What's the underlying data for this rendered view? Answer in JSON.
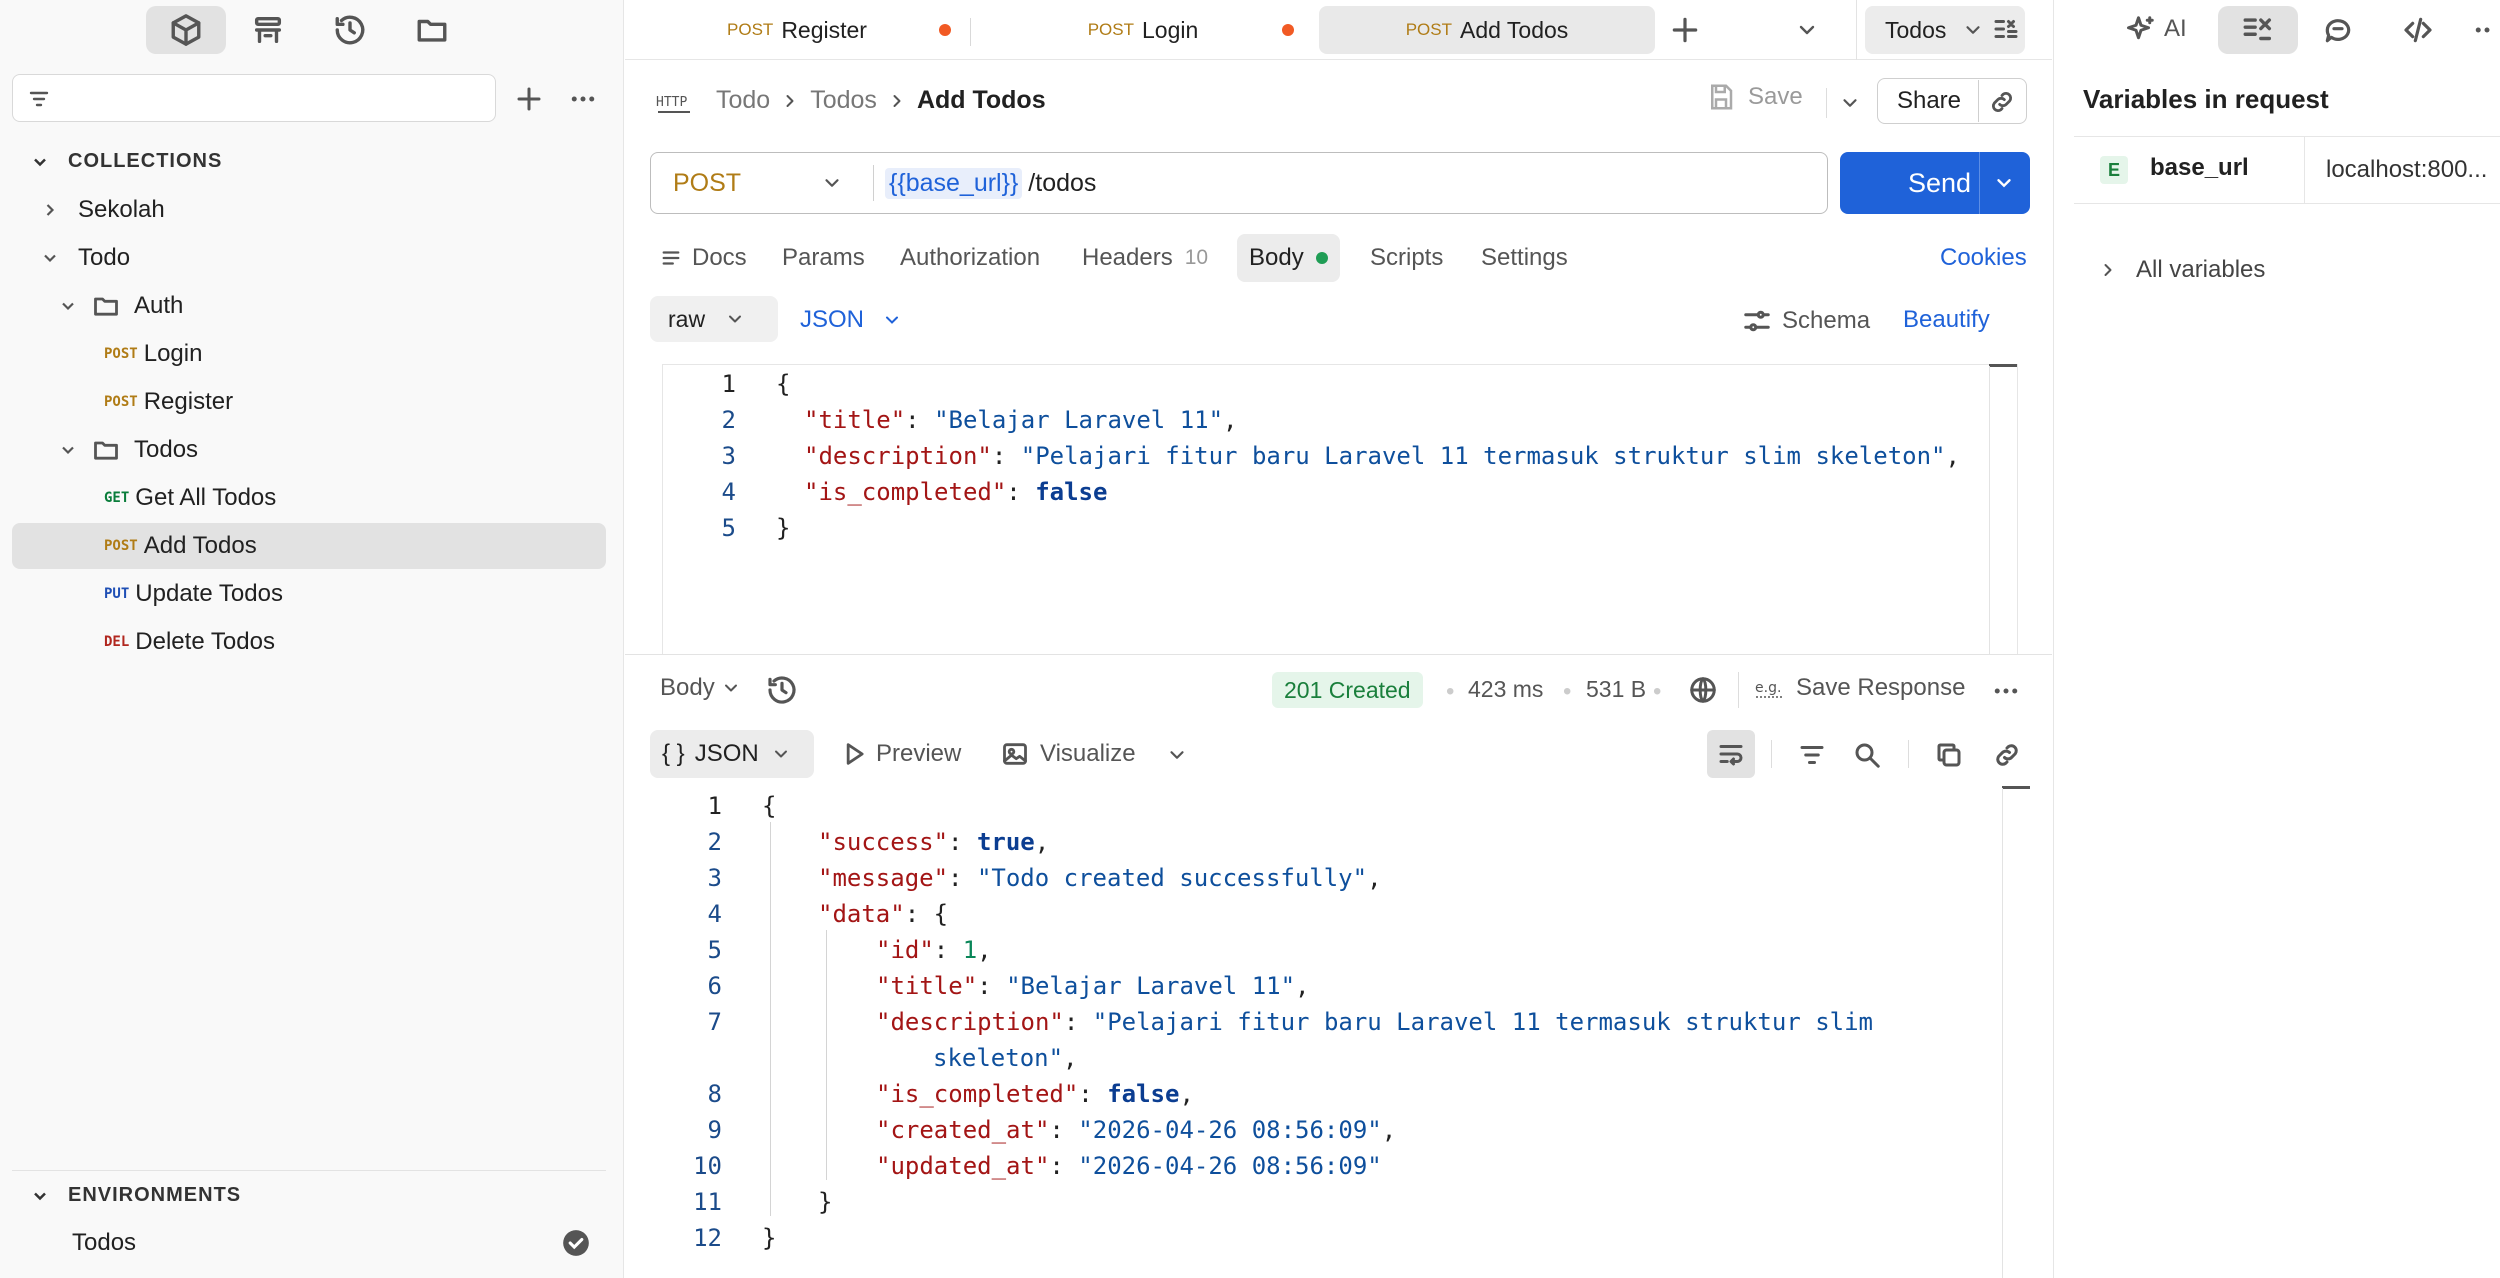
{
  "sidebar": {
    "collections_heading": "COLLECTIONS",
    "environments_heading": "ENVIRONMENTS",
    "tree": [
      {
        "label": "Sekolah"
      },
      {
        "label": "Todo"
      },
      {
        "label": "Auth"
      },
      {
        "method": "POST",
        "label": "Login"
      },
      {
        "method": "POST",
        "label": "Register"
      },
      {
        "label": "Todos"
      },
      {
        "method": "GET",
        "label": "Get All Todos"
      },
      {
        "method": "POST",
        "label": "Add Todos"
      },
      {
        "method": "PUT",
        "label": "Update Todos"
      },
      {
        "method": "DEL",
        "label": "Delete Todos"
      }
    ],
    "env_item": "Todos"
  },
  "tabs": [
    {
      "method": "POST",
      "label": "Register"
    },
    {
      "method": "POST",
      "label": "Login"
    },
    {
      "method": "POST",
      "label": "Add Todos"
    }
  ],
  "env_select": "Todos",
  "breadcrumb": {
    "c1": "Todo",
    "c2": "Todos",
    "current": "Add Todos"
  },
  "header_actions": {
    "save": "Save",
    "share": "Share"
  },
  "request": {
    "method": "POST",
    "url_var": "{{base_url}}",
    "url_path": "/todos",
    "send": "Send"
  },
  "req_tabs": {
    "docs": "Docs",
    "params": "Params",
    "authorization": "Authorization",
    "headers": "Headers",
    "headers_count": "10",
    "body": "Body",
    "scripts": "Scripts",
    "settings": "Settings",
    "cookies": "Cookies"
  },
  "body_opts": {
    "raw": "raw",
    "json": "JSON",
    "schema": "Schema",
    "beautify": "Beautify"
  },
  "request_body": {
    "title_key": "\"title\"",
    "title_val": "\"Belajar Laravel 11\"",
    "desc_key": "\"description\"",
    "desc_val": "\"Pelajari fitur baru Laravel 11 termasuk struktur slim skeleton\"",
    "done_key": "\"is_completed\"",
    "done_val": "false"
  },
  "response": {
    "body_label": "Body",
    "status": "201 Created",
    "time": "423 ms",
    "size": "531 B",
    "save_response": "Save Response",
    "format": "JSON",
    "preview": "Preview",
    "visualize": "Visualize",
    "success_key": "\"success\"",
    "success_val": "true",
    "message_key": "\"message\"",
    "message_val": "\"Todo created successfully\"",
    "data_key": "\"data\"",
    "id_key": "\"id\"",
    "id_val": "1",
    "title_key": "\"title\"",
    "title_val": "\"Belajar Laravel 11\"",
    "desc_key": "\"description\"",
    "desc_val1": "\"Pelajari fitur baru Laravel 11 termasuk struktur slim",
    "desc_val2": "skeleton\"",
    "done_key": "\"is_completed\"",
    "done_val": "false",
    "created_key": "\"created_at\"",
    "created_val": "\"2026-04-26 08:56:09\"",
    "updated_key": "\"updated_at\"",
    "updated_val": "\"2026-04-26 08:56:09\""
  },
  "right_panel": {
    "ai": "AI",
    "title": "Variables in request",
    "var_scope": "E",
    "var_name": "base_url",
    "var_value": "localhost:800...",
    "all_variables": "All variables"
  }
}
